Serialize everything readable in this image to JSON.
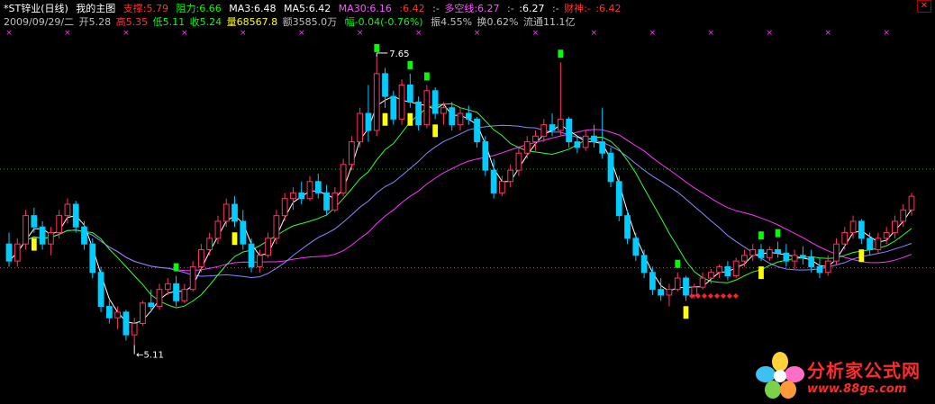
{
  "header": {
    "stock_name": "*ST锌业(日线)",
    "chart_name": "我的主图",
    "support": {
      "label": "支撑:",
      "value": "5.79",
      "color": "#ff3333"
    },
    "resistance": {
      "label": "阻力:",
      "value": "6.66",
      "color": "#00ff00"
    },
    "ma3": {
      "label": "MA3:",
      "value": "6.48",
      "color": "#ffffff"
    },
    "ma5": {
      "label": "MA5:",
      "value": "6.42",
      "color": "#ffffff"
    },
    "ma30": {
      "label": "MA30:",
      "value": "6.16",
      "color": "#ff55ff"
    },
    "extra1": {
      "label": ":",
      "value": "6.42",
      "color": "#ff3333"
    },
    "dash1": {
      "label": ":-",
      "value": "",
      "color": "#c0c0c0"
    },
    "duokong": {
      "label": "多空线:",
      "value": "6.27",
      "color": "#ff55ff"
    },
    "dash2": {
      "label": ":-",
      "value": "",
      "color": "#c0c0c0"
    },
    "extra2": {
      "label": ":",
      "value": "6.27",
      "color": "#ffffff"
    },
    "dash3": {
      "label": ":-",
      "value": "",
      "color": "#c0c0c0"
    },
    "caishen": {
      "label": "财神:-",
      "value": "",
      "color": "#ff3333"
    },
    "extra3": {
      "label": ":",
      "value": "6.42",
      "color": "#ff3333"
    }
  },
  "info": {
    "date": "2009/09/29/二",
    "open": {
      "label": "开",
      "value": "5.28",
      "color": "#c0c0c0"
    },
    "high": {
      "label": "高",
      "value": "5.35",
      "color": "#ff3333"
    },
    "low": {
      "label": "低",
      "value": "5.11",
      "color": "#00ff00"
    },
    "close": {
      "label": "收",
      "value": "5.24",
      "color": "#00ff00"
    },
    "volume": {
      "label": "量",
      "value": "68567.8",
      "color": "#ffff00"
    },
    "amount": {
      "label": "额",
      "value": "3585.0万",
      "color": "#c0c0c0"
    },
    "change": {
      "label": "幅",
      "value": "-0.04(-0.76%)",
      "color": "#00ff00"
    },
    "amplitude": {
      "label": "振",
      "value": "4.55%",
      "color": "#c0c0c0"
    },
    "turnover": {
      "label": "换",
      "value": "0.62%",
      "color": "#c0c0c0"
    },
    "float_cap": {
      "label": "流通",
      "value": "11.1亿",
      "color": "#c0c0c0"
    }
  },
  "annotations": {
    "high_label": "7.65",
    "low_label": "5.11"
  },
  "colors": {
    "up": "#ff3366",
    "down": "#00ccff",
    "ma_fast": "#ffffff",
    "ma_mid": "#33ff33",
    "ma_slow": "#8888ff",
    "ma30": "#ff33ff",
    "signal_yellow": "#ffff00",
    "signal_green": "#00ff00",
    "cross_mark": "#ff33ff"
  },
  "chart_data": {
    "type": "candlestick",
    "symbol": "*ST锌业",
    "period": "日线",
    "ylim": [
      4.9,
      7.8
    ],
    "reference_lines": [
      {
        "value": 6.66,
        "style": "dotted",
        "color": "#00aa00"
      },
      {
        "value": 5.79,
        "style": "dotted",
        "color": "#ff3333"
      }
    ],
    "candles_ohlc": [
      [
        6.0,
        6.1,
        5.8,
        5.85
      ],
      [
        5.85,
        6.05,
        5.8,
        6.0
      ],
      [
        6.0,
        6.3,
        5.95,
        6.25
      ],
      [
        6.25,
        6.32,
        6.1,
        6.15
      ],
      [
        6.15,
        6.2,
        5.95,
        6.0
      ],
      [
        6.0,
        6.15,
        5.9,
        6.1
      ],
      [
        6.1,
        6.3,
        6.05,
        6.25
      ],
      [
        6.25,
        6.4,
        6.18,
        6.35
      ],
      [
        6.35,
        6.38,
        6.1,
        6.15
      ],
      [
        6.15,
        6.2,
        5.95,
        6.0
      ],
      [
        6.0,
        6.05,
        5.7,
        5.75
      ],
      [
        5.75,
        5.8,
        5.4,
        5.45
      ],
      [
        5.45,
        5.5,
        5.3,
        5.35
      ],
      [
        5.35,
        5.45,
        5.25,
        5.4
      ],
      [
        5.4,
        5.42,
        5.15,
        5.2
      ],
      [
        5.2,
        5.35,
        5.11,
        5.3
      ],
      [
        5.3,
        5.5,
        5.28,
        5.48
      ],
      [
        5.48,
        5.6,
        5.4,
        5.45
      ],
      [
        5.45,
        5.65,
        5.42,
        5.6
      ],
      [
        5.6,
        5.7,
        5.55,
        5.65
      ],
      [
        5.65,
        5.72,
        5.45,
        5.5
      ],
      [
        5.5,
        5.65,
        5.48,
        5.6
      ],
      [
        5.6,
        5.85,
        5.58,
        5.8
      ],
      [
        5.8,
        6.0,
        5.75,
        5.95
      ],
      [
        5.95,
        6.1,
        5.9,
        6.05
      ],
      [
        6.05,
        6.25,
        6.0,
        6.2
      ],
      [
        6.2,
        6.4,
        6.15,
        6.35
      ],
      [
        6.35,
        6.42,
        6.15,
        6.2
      ],
      [
        6.2,
        6.3,
        5.95,
        6.0
      ],
      [
        6.0,
        6.05,
        5.75,
        5.8
      ],
      [
        5.8,
        5.95,
        5.75,
        5.9
      ],
      [
        5.9,
        6.1,
        5.88,
        6.05
      ],
      [
        6.05,
        6.3,
        6.0,
        6.25
      ],
      [
        6.25,
        6.45,
        6.2,
        6.4
      ],
      [
        6.4,
        6.5,
        6.3,
        6.45
      ],
      [
        6.45,
        6.55,
        6.35,
        6.4
      ],
      [
        6.4,
        6.6,
        6.38,
        6.55
      ],
      [
        6.55,
        6.62,
        6.4,
        6.45
      ],
      [
        6.45,
        6.52,
        6.25,
        6.3
      ],
      [
        6.3,
        6.5,
        6.28,
        6.45
      ],
      [
        6.45,
        6.75,
        6.42,
        6.7
      ],
      [
        6.7,
        6.95,
        6.65,
        6.9
      ],
      [
        6.9,
        7.2,
        6.85,
        7.15
      ],
      [
        7.15,
        7.4,
        6.9,
        7.0
      ],
      [
        7.0,
        7.65,
        6.95,
        7.5
      ],
      [
        7.5,
        7.55,
        7.2,
        7.3
      ],
      [
        7.3,
        7.35,
        7.05,
        7.1
      ],
      [
        7.1,
        7.45,
        7.05,
        7.4
      ],
      [
        7.4,
        7.5,
        7.2,
        7.25
      ],
      [
        7.25,
        7.3,
        7.0,
        7.05
      ],
      [
        7.05,
        7.4,
        7.02,
        7.35
      ],
      [
        7.35,
        7.38,
        7.1,
        7.15
      ],
      [
        7.15,
        7.25,
        7.05,
        7.2
      ],
      [
        7.2,
        7.25,
        7.0,
        7.05
      ],
      [
        7.05,
        7.2,
        7.0,
        7.15
      ],
      [
        7.15,
        7.22,
        7.05,
        7.1
      ],
      [
        7.1,
        7.12,
        6.85,
        6.9
      ],
      [
        6.9,
        6.95,
        6.6,
        6.65
      ],
      [
        6.65,
        6.75,
        6.4,
        6.45
      ],
      [
        6.45,
        6.6,
        6.42,
        6.55
      ],
      [
        6.55,
        6.7,
        6.5,
        6.65
      ],
      [
        6.65,
        6.85,
        6.6,
        6.8
      ],
      [
        6.8,
        6.95,
        6.75,
        6.9
      ],
      [
        6.9,
        7.0,
        6.82,
        6.95
      ],
      [
        6.95,
        7.1,
        6.9,
        7.05
      ],
      [
        7.05,
        7.15,
        6.95,
        7.0
      ],
      [
        7.0,
        7.6,
        6.95,
        7.1
      ],
      [
        7.1,
        7.12,
        6.85,
        6.9
      ],
      [
        6.9,
        6.95,
        6.8,
        6.85
      ],
      [
        6.85,
        7.0,
        6.82,
        6.95
      ],
      [
        6.95,
        7.05,
        6.85,
        6.9
      ],
      [
        6.9,
        7.2,
        6.75,
        6.8
      ],
      [
        6.8,
        6.85,
        6.5,
        6.55
      ],
      [
        6.55,
        6.6,
        6.2,
        6.25
      ],
      [
        6.25,
        6.3,
        6.0,
        6.05
      ],
      [
        6.05,
        6.1,
        5.85,
        5.9
      ],
      [
        5.9,
        5.95,
        5.7,
        5.75
      ],
      [
        5.75,
        5.8,
        5.55,
        5.6
      ],
      [
        5.6,
        5.7,
        5.5,
        5.55
      ],
      [
        5.55,
        5.65,
        5.45,
        5.6
      ],
      [
        5.6,
        5.75,
        5.58,
        5.7
      ],
      [
        5.7,
        5.72,
        5.5,
        5.55
      ],
      [
        5.55,
        5.65,
        5.52,
        5.62
      ],
      [
        5.62,
        5.75,
        5.6,
        5.7
      ],
      [
        5.7,
        5.78,
        5.65,
        5.75
      ],
      [
        5.75,
        5.82,
        5.7,
        5.8
      ],
      [
        5.8,
        5.85,
        5.68,
        5.72
      ],
      [
        5.72,
        5.88,
        5.7,
        5.85
      ],
      [
        5.85,
        5.95,
        5.8,
        5.9
      ],
      [
        5.9,
        6.0,
        5.85,
        5.95
      ],
      [
        5.95,
        6.0,
        5.85,
        5.88
      ],
      [
        5.88,
        5.98,
        5.85,
        5.95
      ],
      [
        5.95,
        6.02,
        5.88,
        5.92
      ],
      [
        5.92,
        6.0,
        5.8,
        5.85
      ],
      [
        5.85,
        5.95,
        5.78,
        5.9
      ],
      [
        5.9,
        5.98,
        5.82,
        5.88
      ],
      [
        5.88,
        5.95,
        5.75,
        5.8
      ],
      [
        5.8,
        5.88,
        5.7,
        5.75
      ],
      [
        5.75,
        5.9,
        5.72,
        5.85
      ],
      [
        5.85,
        6.05,
        5.82,
        6.0
      ],
      [
        6.0,
        6.15,
        5.95,
        6.1
      ],
      [
        6.1,
        6.25,
        6.05,
        6.2
      ],
      [
        6.2,
        6.22,
        6.0,
        6.05
      ],
      [
        6.05,
        6.1,
        5.9,
        5.95
      ],
      [
        5.95,
        6.1,
        5.92,
        6.05
      ],
      [
        6.05,
        6.15,
        6.0,
        6.1
      ],
      [
        6.1,
        6.25,
        6.05,
        6.2
      ],
      [
        6.2,
        6.35,
        6.15,
        6.3
      ],
      [
        6.3,
        6.45,
        6.25,
        6.42
      ]
    ],
    "markers": {
      "high": {
        "label": "7.65"
      },
      "low": {
        "label": "5.11"
      }
    }
  }
}
